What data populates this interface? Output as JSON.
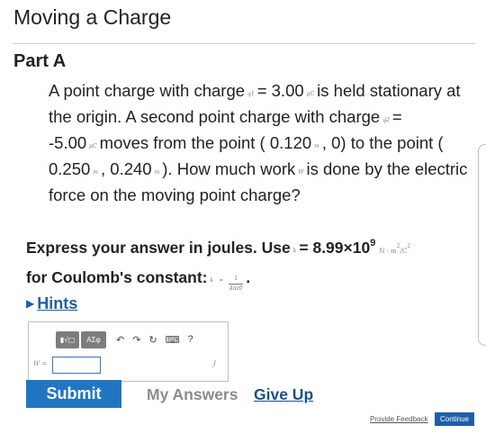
{
  "page": {
    "title": "Moving a Charge",
    "part_label": "Part A"
  },
  "problem": {
    "t1": "A point charge with charge",
    "sym_q1": "q1",
    "t2": "= 3.00",
    "unit_uc1": "μC",
    "t3": "is held stationary at the origin. A second point charge with charge",
    "sym_q2": "q2",
    "t4": "= -5.00",
    "unit_uc2": "μC",
    "t5": "moves from the point ( 0.120",
    "unit_m1": "m",
    "t6": ", 0) to the point ( 0.250",
    "unit_m2": "m",
    "t7": ", 0.240",
    "unit_m3": "m",
    "t8": "). How much work",
    "sym_w": "W",
    "t9": "is done by the electric force on the moving point charge?"
  },
  "instruction": {
    "t1": "Express your answer in joules. Use",
    "sym_k": "k",
    "t2": "= 8.99×10",
    "exponent": "9",
    "unit": "N · m",
    "unit_sup": "2",
    "unit_tail": "/C",
    "unit_tail_sup": "2",
    "t3": "for Coulomb's constant:",
    "sym_k2": "k",
    "eq": "=",
    "frac_num": "1",
    "frac_den": "4πε0",
    "t4": "."
  },
  "hints": {
    "label": "Hints"
  },
  "answer": {
    "toolbar": {
      "template_btn": "▮√▢",
      "greek_btn": "ΑΣφ",
      "help": "?"
    },
    "icons": [
      "undo-icon",
      "redo-icon",
      "reset-icon",
      "keyboard-icon",
      "help-icon"
    ],
    "variable_label": "W =",
    "value": "",
    "unit_label": "J"
  },
  "actions": {
    "submit": "Submit",
    "my_answers": "My Answers",
    "give_up": "Give Up",
    "provide_feedback": "Provide Feedback",
    "continue": "Continue"
  },
  "colors": {
    "accent": "#2176c2",
    "link": "#1f5fa6"
  }
}
